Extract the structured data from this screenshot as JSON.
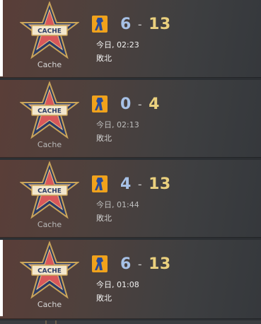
{
  "matches": [
    {
      "map": "Cache",
      "badge_text": "CACHE",
      "score_ct": "6",
      "score_sep": "-",
      "score_t": "13",
      "time": "今日, 02:23",
      "result": "敗北"
    },
    {
      "map": "Cache",
      "badge_text": "CACHE",
      "score_ct": "0",
      "score_sep": "-",
      "score_t": "4",
      "time": "今日, 02:13",
      "result": "敗北"
    },
    {
      "map": "Cache",
      "badge_text": "CACHE",
      "score_ct": "4",
      "score_sep": "-",
      "score_t": "13",
      "time": "今日, 01:44",
      "result": "敗北"
    },
    {
      "map": "Cache",
      "badge_text": "CACHE",
      "score_ct": "6",
      "score_sep": "-",
      "score_t": "13",
      "time": "今日, 01:08",
      "result": "敗北"
    }
  ],
  "icons": {
    "badge": "cache-map-star-badge-icon",
    "team": "ct-team-icon"
  },
  "colors": {
    "ct_score": "#a7c1e6",
    "t_score": "#ead07e",
    "team_icon_bg": "#f0a21c",
    "team_icon_fg": "#2a4a96",
    "star_red": "#d8585a",
    "badge_gold": "#c9a45a",
    "badge_navy": "#2b3b66"
  }
}
